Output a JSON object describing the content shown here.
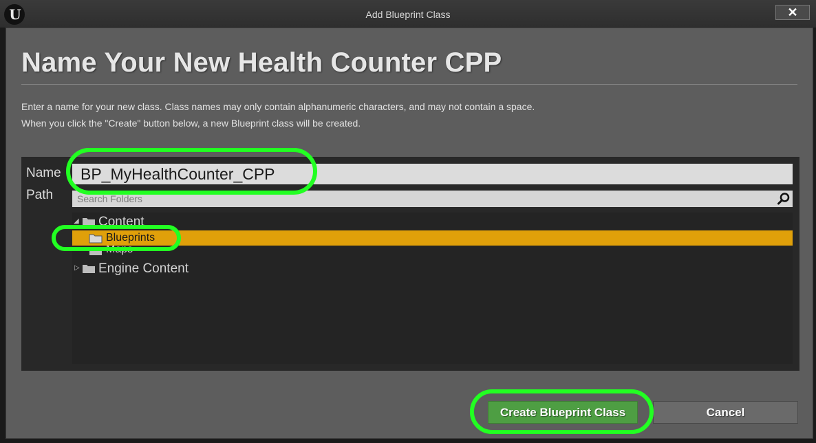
{
  "window": {
    "title": "Add Blueprint Class",
    "logo_icon": "unreal-engine-logo-icon",
    "close_label": "✕"
  },
  "dialog": {
    "heading": "Name Your New Health Counter CPP",
    "description_line1": "Enter a name for your new class. Class names may only contain alphanumeric characters, and may not contain a space.",
    "description_line2": "When you click the \"Create\" button below, a new Blueprint class will be created."
  },
  "form": {
    "name_label": "Name",
    "name_value": "BP_MyHealthCounter_CPP",
    "path_label": "Path",
    "search_placeholder": "Search Folders"
  },
  "folders": [
    {
      "label": "Content",
      "expanded": true,
      "selected": false
    },
    {
      "label": "Blueprints",
      "expanded": false,
      "selected": true
    },
    {
      "label": "Maps",
      "expanded": false,
      "selected": false
    },
    {
      "label": "Engine Content",
      "expanded": false,
      "selected": false
    }
  ],
  "buttons": {
    "create_label": "Create Blueprint Class",
    "cancel_label": "Cancel"
  },
  "colors": {
    "selection": "#e0a00a",
    "create_button": "#4e9e43",
    "annotation_highlight": "#22ff22"
  }
}
